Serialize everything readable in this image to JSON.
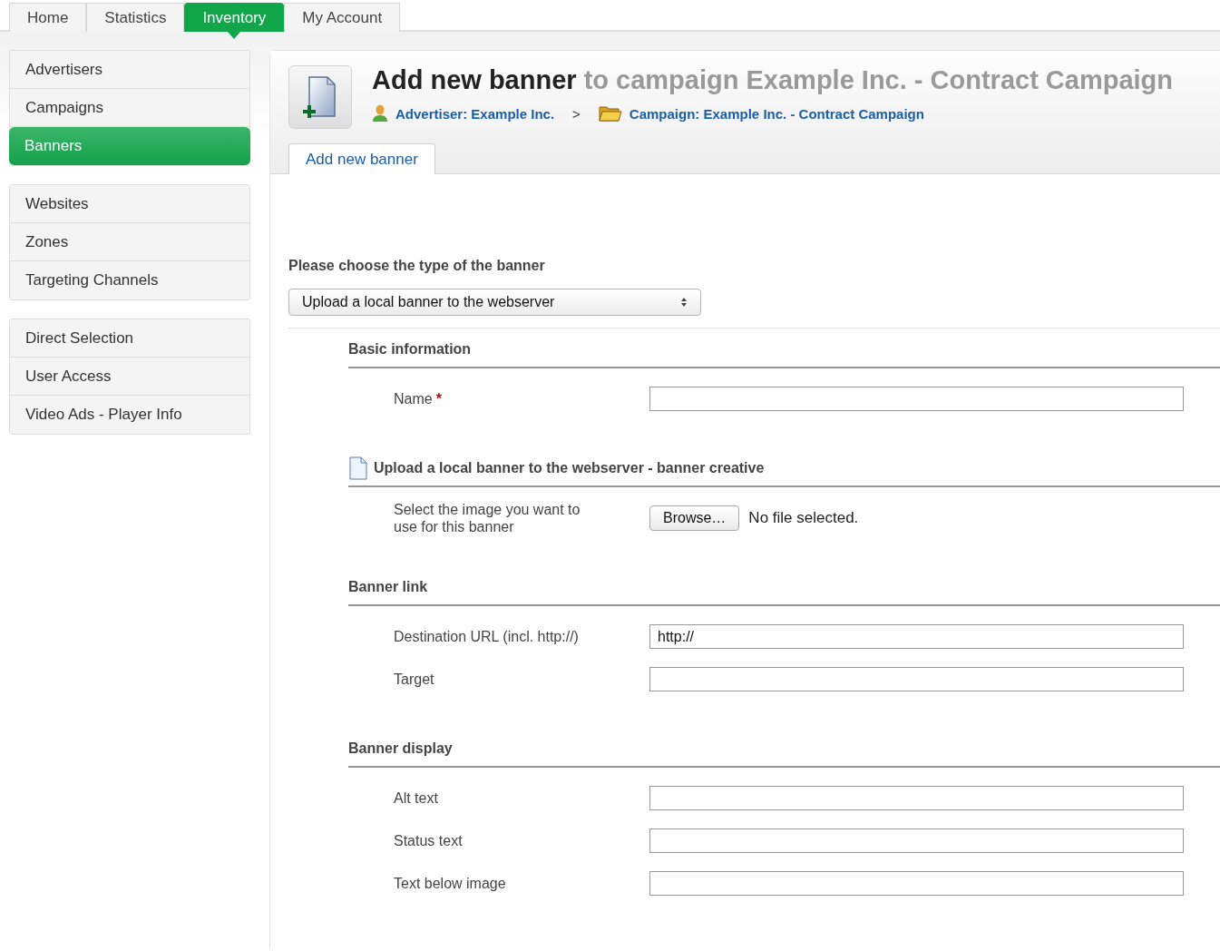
{
  "top_tabs": [
    {
      "label": "Home",
      "selected": false
    },
    {
      "label": "Statistics",
      "selected": false
    },
    {
      "label": "Inventory",
      "selected": true
    },
    {
      "label": "My Account",
      "selected": false
    }
  ],
  "sidebar_groups": [
    {
      "items": [
        {
          "label": "Advertisers",
          "selected": false
        },
        {
          "label": "Campaigns",
          "selected": false
        },
        {
          "label": "Banners",
          "selected": true
        }
      ]
    },
    {
      "items": [
        {
          "label": "Websites",
          "selected": false
        },
        {
          "label": "Zones",
          "selected": false
        },
        {
          "label": "Targeting Channels",
          "selected": false
        }
      ]
    },
    {
      "items": [
        {
          "label": "Direct Selection",
          "selected": false
        },
        {
          "label": "User Access",
          "selected": false
        },
        {
          "label": "Video Ads - Player Info",
          "selected": false
        }
      ]
    }
  ],
  "header": {
    "title": "Add new banner",
    "subtitle": "to campaign Example Inc. - Contract Campaign",
    "breadcrumbs": [
      {
        "kind": "advertiser",
        "label": "Advertiser: Example Inc."
      },
      {
        "kind": "campaign",
        "label": "Campaign: Example Inc. - Contract Campaign"
      }
    ],
    "separator": ">"
  },
  "page_tabs": [
    {
      "label": "Add new banner",
      "selected": true
    }
  ],
  "banner_type": {
    "label": "Please choose the type of the banner",
    "value": "Upload a local banner to the webserver"
  },
  "sections": [
    {
      "kind": "plain",
      "heading": "Basic information",
      "fields": [
        {
          "kind": "text",
          "label": "Name",
          "required_mark": "*"
        }
      ]
    },
    {
      "kind": "creative",
      "heading": "Upload a local banner to the webserver - banner creative",
      "fields": [
        {
          "kind": "file",
          "label": "Select the image you want to use for this banner",
          "button": "Browse…",
          "status": "No file selected."
        }
      ]
    },
    {
      "kind": "plain",
      "heading": "Banner link",
      "fields": [
        {
          "kind": "text",
          "label": "Destination URL (incl. http://)",
          "value": "http://"
        },
        {
          "kind": "text",
          "label": "Target"
        }
      ]
    },
    {
      "kind": "plain",
      "heading": "Banner display",
      "fields": [
        {
          "kind": "text",
          "label": "Alt text"
        },
        {
          "kind": "text",
          "label": "Status text"
        },
        {
          "kind": "text",
          "label": "Text below image"
        }
      ]
    }
  ]
}
